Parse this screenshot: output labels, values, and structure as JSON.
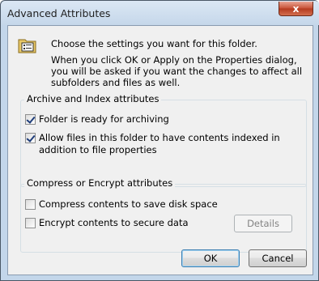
{
  "window": {
    "title": "Advanced Attributes",
    "close_label": "x"
  },
  "intro": {
    "line1": "Choose the settings you want for this folder.",
    "line2": "When you click OK or Apply on the Properties dialog, you will be asked if you want the changes to affect all subfolders and files as well."
  },
  "archive_group": {
    "label": "Archive and Index attributes",
    "items": [
      {
        "label": "Folder is ready for archiving",
        "checked": true
      },
      {
        "label": "Allow files in this folder to have contents indexed in addition to file properties",
        "checked": true
      }
    ]
  },
  "compress_group": {
    "label": "Compress or Encrypt attributes",
    "items": [
      {
        "label": "Compress contents to save disk space",
        "checked": false
      },
      {
        "label": "Encrypt contents to secure data",
        "checked": false
      }
    ],
    "details_label": "Details"
  },
  "buttons": {
    "ok": "OK",
    "cancel": "Cancel"
  },
  "icons": {
    "folder": "folder-properties-icon"
  }
}
